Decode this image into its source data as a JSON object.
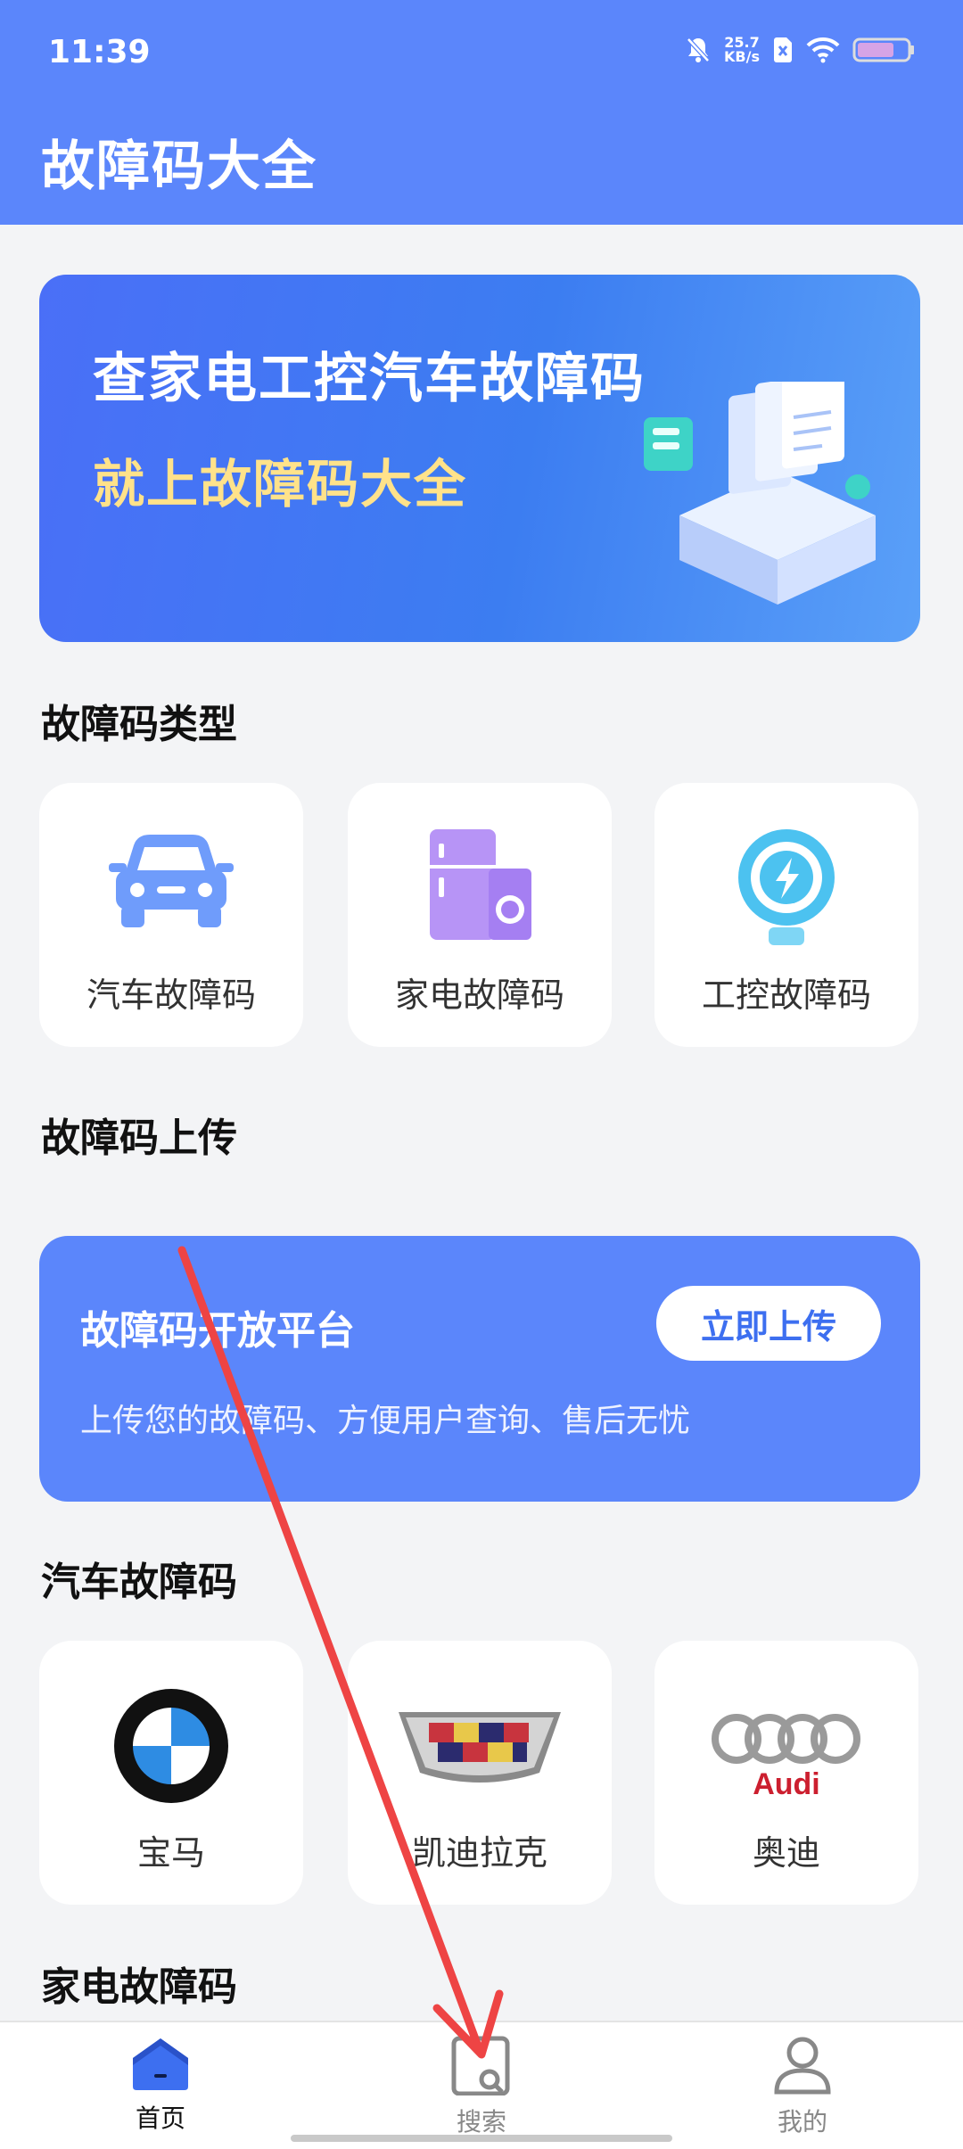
{
  "status_bar": {
    "time": "11:39",
    "net_speed_value": "25.7",
    "net_speed_unit": "KB/s",
    "icons": [
      "bell-muted-icon",
      "sim-off-icon",
      "wifi-icon",
      "battery-icon"
    ]
  },
  "app_bar": {
    "title": "故障码大全"
  },
  "banner": {
    "line1": "查家电工控汽车故障码",
    "line2": "就上故障码大全"
  },
  "sections": {
    "types_title": "故障码类型",
    "upload_title": "故障码上传",
    "car_title": "汽车故障码",
    "appliance_title": "家电故障码"
  },
  "types": [
    {
      "label": "汽车故障码",
      "icon": "car-icon"
    },
    {
      "label": "家电故障码",
      "icon": "appliance-icon"
    },
    {
      "label": "工控故障码",
      "icon": "industrial-control-icon"
    }
  ],
  "upload": {
    "title": "故障码开放平台",
    "description": "上传您的故障码、方便用户查询、售后无忧",
    "button": "立即上传"
  },
  "car_brands": [
    {
      "label": "宝马",
      "icon": "bmw-logo-icon"
    },
    {
      "label": "凯迪拉克",
      "icon": "cadillac-logo-icon"
    },
    {
      "label": "奥迪",
      "icon": "audi-logo-icon",
      "logo_text": "Audi"
    }
  ],
  "bottom_nav": [
    {
      "label": "首页",
      "icon": "home-icon",
      "active": true
    },
    {
      "label": "搜索",
      "icon": "search-icon",
      "active": false
    },
    {
      "label": "我的",
      "icon": "profile-icon",
      "active": false
    }
  ],
  "colors": {
    "primary": "#5b86fb",
    "banner_highlight": "#ffe28a",
    "nav_active": "#3d6ff0",
    "nav_inactive": "#888888",
    "annotation": "#ee4444"
  }
}
